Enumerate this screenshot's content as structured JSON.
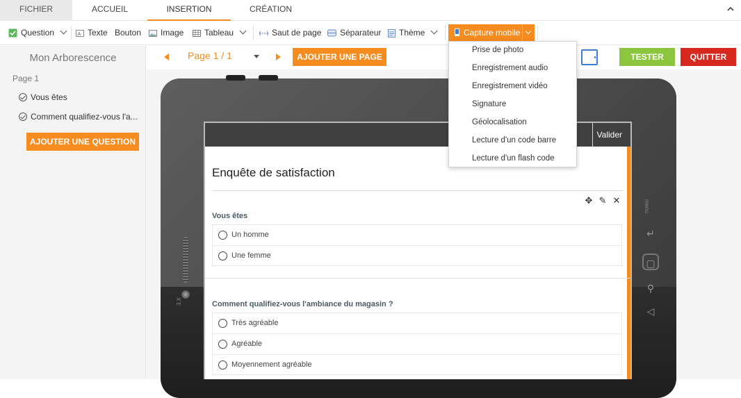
{
  "menu": {
    "tabs": [
      {
        "label": "FICHIER"
      },
      {
        "label": "ACCUEIL"
      },
      {
        "label": "INSERTION"
      },
      {
        "label": "CRÉATION"
      }
    ]
  },
  "toolbar": {
    "question": "Question",
    "texte": "Texte",
    "bouton": "Bouton",
    "image": "Image",
    "tableau": "Tableau",
    "saut_de_page": "Saut de page",
    "separateur": "Séparateur",
    "theme": "Thème",
    "capture_mobile": "Capture mobile"
  },
  "capture_menu": {
    "items": [
      "Prise de photo",
      "Enregistrement audio",
      "Enregistrement vidéo",
      "Signature",
      "Géolocalisation",
      "Lecture d'un code barre",
      "Lecture d'un flash code"
    ]
  },
  "sidebar": {
    "title": "Mon Arborescence",
    "page": "Page 1",
    "questions": [
      "Vous êtes",
      "Comment qualifiez-vous l'a..."
    ],
    "add_question": "AJOUTER UNE QUESTION"
  },
  "nav": {
    "page_label": "Page 1 / 1",
    "add_page": "AJOUTER UNE PAGE",
    "tester": "TESTER",
    "quitter": "QUITTER"
  },
  "device": {
    "brand": "3.X",
    "side_text": "menu"
  },
  "survey": {
    "valider": "Valider",
    "title": "Enquête de satisfaction",
    "questions": [
      {
        "label": "Vous êtes",
        "options": [
          "Un homme",
          "Une femme"
        ]
      },
      {
        "label": "Comment qualifiez-vous l'ambiance du magasin ?",
        "options": [
          "Très agréable",
          "Agréable",
          "Moyennement agréable"
        ]
      }
    ]
  },
  "colors": {
    "accent": "#f68b1f",
    "tester": "#8cc63f",
    "quitter": "#d7281f",
    "selected_icon": "#3b7dd8"
  }
}
